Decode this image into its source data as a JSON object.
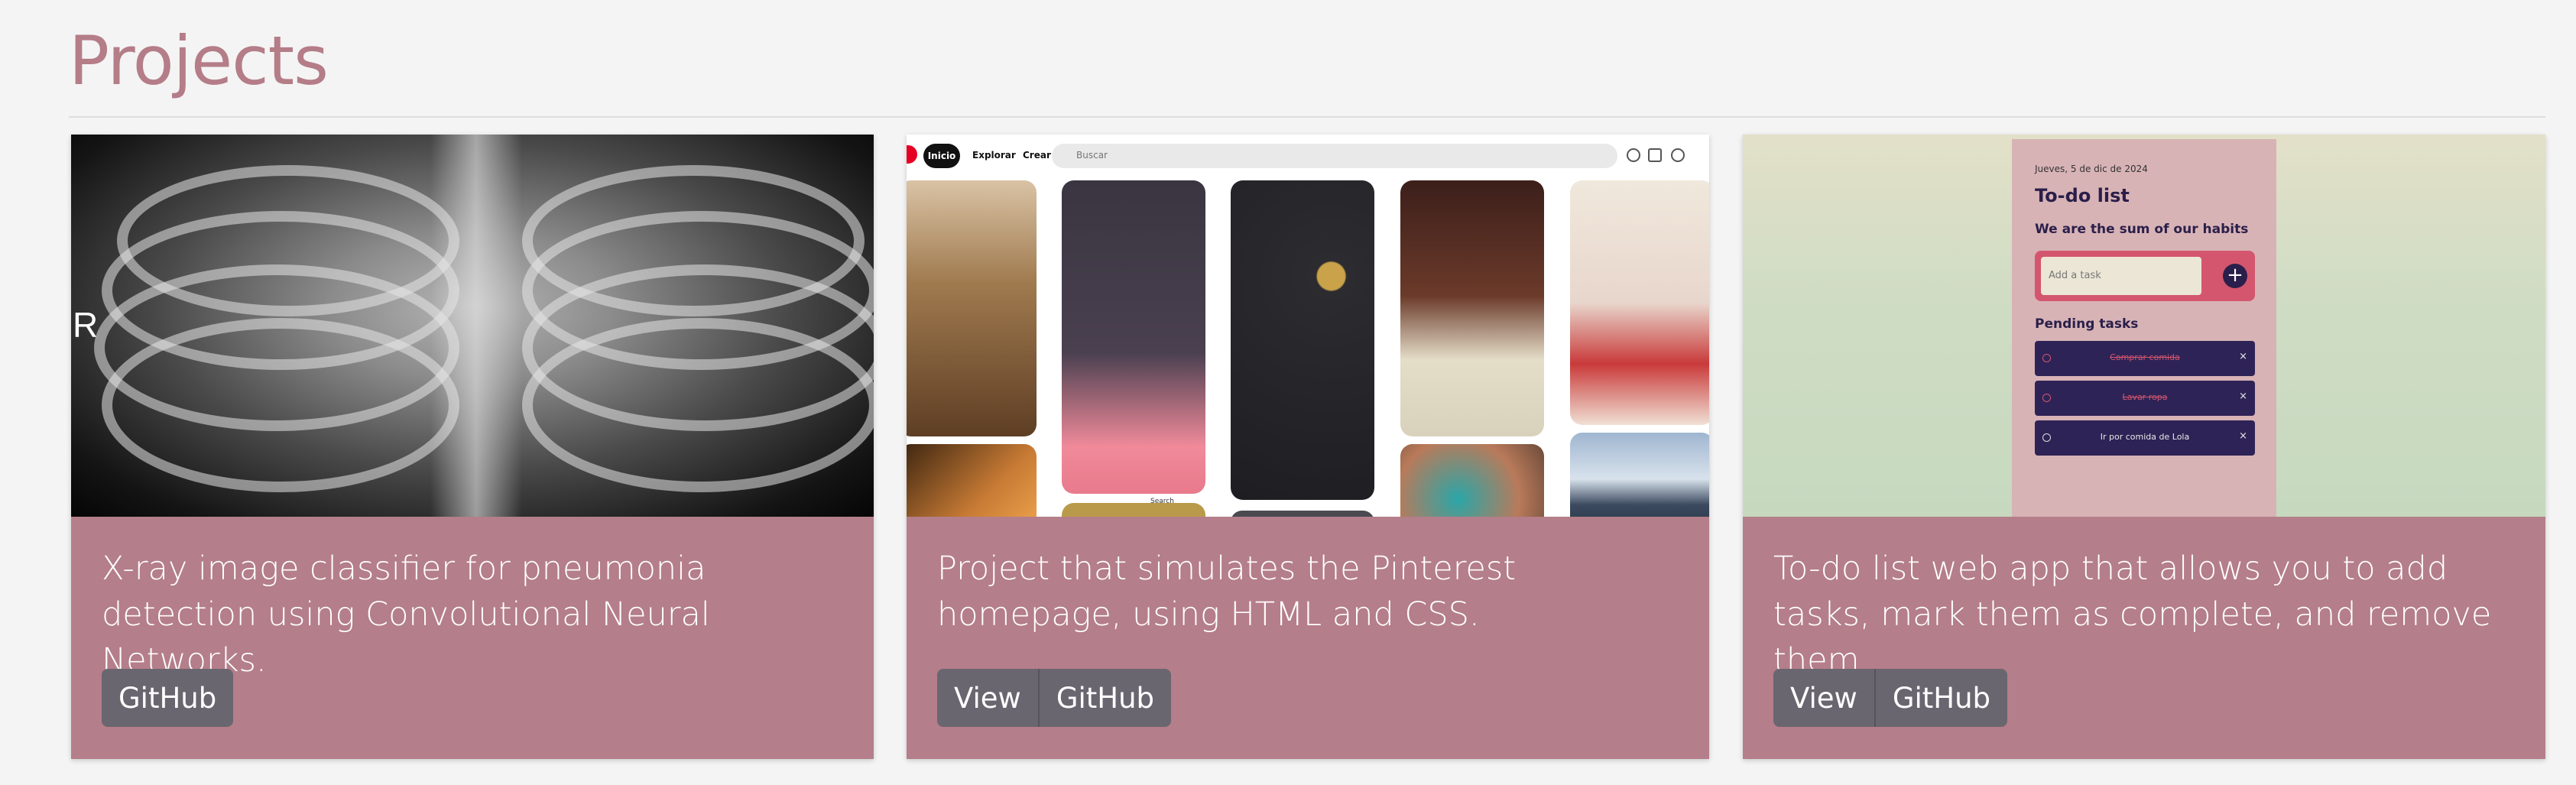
{
  "section": {
    "title": "Projects"
  },
  "projects": [
    {
      "id": "xray",
      "description": "X-ray image classifier for pneumonia detection using Convolutional Neural Networks.",
      "buttons": [
        "GitHub"
      ],
      "thumb": {
        "label": "R"
      }
    },
    {
      "id": "pinterest",
      "description": "Project that simulates the Pinterest homepage, using HTML and CSS.",
      "buttons": [
        "View",
        "GitHub"
      ],
      "thumb": {
        "nav_home": "Inicio",
        "nav_explore": "Explorar",
        "nav_create": "Crear",
        "search_placeholder": "Buscar",
        "pin_caption": "Search"
      }
    },
    {
      "id": "todo",
      "description": "To-do list web app that allows you to add tasks, mark them as complete, and remove them.",
      "buttons": [
        "View",
        "GitHub"
      ],
      "thumb": {
        "date": "Jueves, 5 de dic de 2024",
        "title": "To-do list",
        "subtitle": "We are the sum of our habits",
        "input_placeholder": "Add a task",
        "add_symbol": "+",
        "pending_label": "Pending tasks",
        "tasks": [
          {
            "text": "Comprar comida",
            "done": true
          },
          {
            "text": "Lavar ropa",
            "done": true
          },
          {
            "text": "Ir por comida de Lola",
            "done": false
          }
        ],
        "remove_symbol": "×"
      }
    }
  ],
  "colors": {
    "heading": "#b47d88",
    "card": "#b47e8a",
    "button": "#6a6670",
    "background": "#f4f4f4"
  }
}
